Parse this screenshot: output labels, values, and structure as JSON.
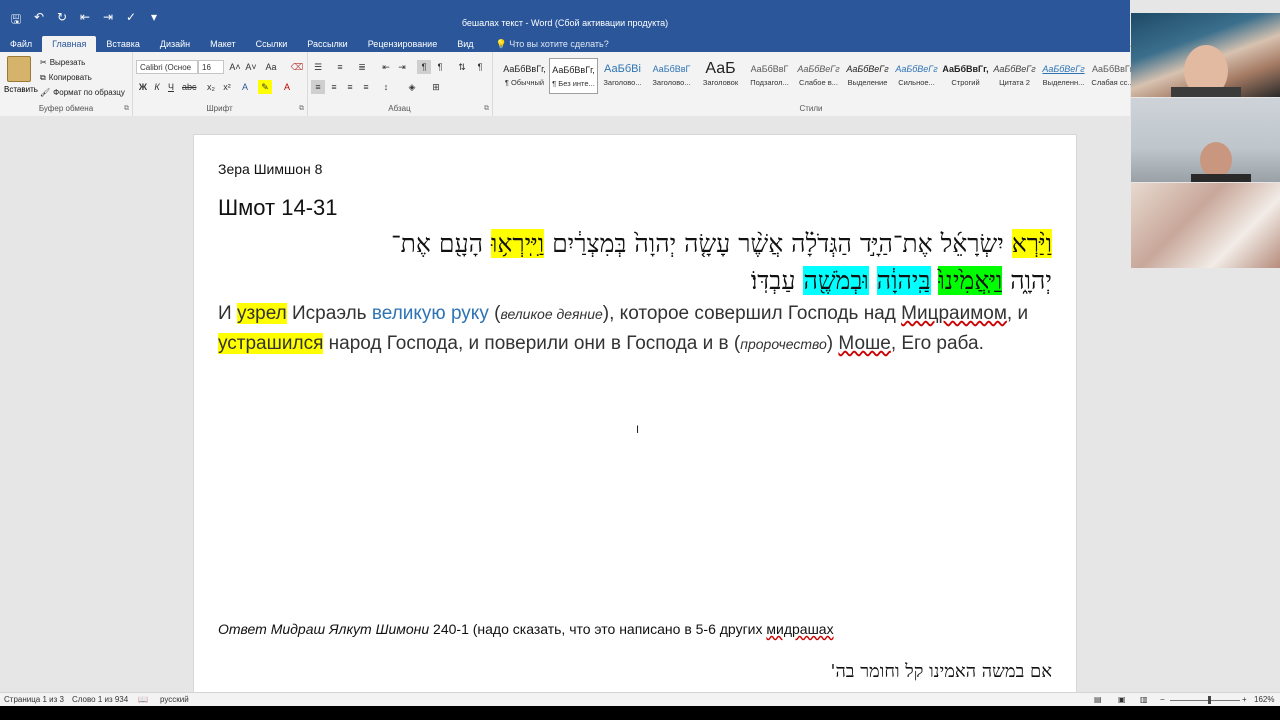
{
  "window": {
    "title": "бешалах текст - Word (Сбой активации продукта)"
  },
  "tabs": [
    "Файл",
    "Главная",
    "Вставка",
    "Дизайн",
    "Макет",
    "Ссылки",
    "Рассылки",
    "Рецензирование",
    "Вид"
  ],
  "active_tab": "Главная",
  "tell_me": "Что вы хотите сделать?",
  "ribbon": {
    "clipboard": {
      "paste": "Вставить",
      "cut": "Вырезать",
      "copy": "Копировать",
      "format_painter": "Формат по образцу",
      "label": "Буфер обмена"
    },
    "font": {
      "name": "Calibri (Осное",
      "size": "16",
      "label": "Шрифт"
    },
    "paragraph": {
      "label": "Абзац"
    },
    "styles": {
      "label": "Стили",
      "items": [
        {
          "preview": "АаБбВвГг,",
          "name": "¶ Обычный"
        },
        {
          "preview": "АаБбВвГг,",
          "name": "¶ Без инте..."
        },
        {
          "preview": "АаБбВі",
          "name": "Заголово..."
        },
        {
          "preview": "АаБбВвГ",
          "name": "Заголово..."
        },
        {
          "preview": "АаБ",
          "name": "Заголовок"
        },
        {
          "preview": "АаБбВвГ",
          "name": "Подзагол..."
        },
        {
          "preview": "АаБбВеГг",
          "name": "Слабое в..."
        },
        {
          "preview": "АаБбВеГг",
          "name": "Выделение"
        },
        {
          "preview": "АаБбВеГг",
          "name": "Сильное..."
        },
        {
          "preview": "АаБбВвГг,",
          "name": "Строгий"
        },
        {
          "preview": "АаБбВеГг",
          "name": "Цитата 2"
        },
        {
          "preview": "АаБбВеГг",
          "name": "Выделенн..."
        },
        {
          "preview": "АаБбВвГг",
          "name": "Слабая сс..."
        }
      ]
    }
  },
  "document": {
    "line1": "Зера Шимшон 8",
    "heading": "Шмот 14-31",
    "hebrew_line1": {
      "p1": "וַיַּ֨רְא",
      "p2": " יִשְׂרָאֵ֜ל אֶת־הַיָּ֣ד הַגְּדֹלָ֗ה אֲשֶׁ֨ר עָשָׂ֤ה יְהוָה֙ בְּמִצְרַ֔יִם ",
      "p3": "וַיִּֽירְא֥וּ",
      "p4": " הָעָ֖ם אֶת־"
    },
    "hebrew_line2": {
      "p1": "יְהוָ֑ה ",
      "p2": "וַיַּֽאֲמִ֙ינוּ֙",
      "p3": " ",
      "p4": "בַּֽיהוָ֔ה",
      "p5": " ",
      "p6": "וּבְמֹשֶׁ֖ה",
      "p7": " עַבְדּֽוֹ׃"
    },
    "translation": {
      "t1": "И ",
      "t2": "узрел",
      "t3": " Исраэль ",
      "t4": "великую руку",
      "t5": " (",
      "t6": "великое деяние",
      "t7": "), которое совершил Господь над ",
      "t8": "Мицраимом",
      "t9": ", и ",
      "t10": "устрашился",
      "t11": " народ Господа, и поверили они в Господа и в (",
      "t12": "пророчество",
      "t13": ") ",
      "t14": "Моше",
      "t15": ", Его раба."
    },
    "answer": {
      "a1": "Ответ Мидраш Ялкут Шимони",
      "a2": " 240-1 (надо сказать, что это написано в 5-6 других ",
      "a3": "мидрашах"
    },
    "hebrew_bottom": "אם במשה האמינו קל וחומר בה'"
  },
  "statusbar": {
    "page": "Страница 1 из 3",
    "words": "Слово 1 из 934",
    "language": "русский",
    "zoom": "162%"
  },
  "colors": {
    "titlebar": "#2b579a",
    "highlight_yellow": "#ffff00",
    "highlight_green": "#00ff00",
    "highlight_cyan": "#00ffff",
    "link_blue": "#2e74b5"
  }
}
